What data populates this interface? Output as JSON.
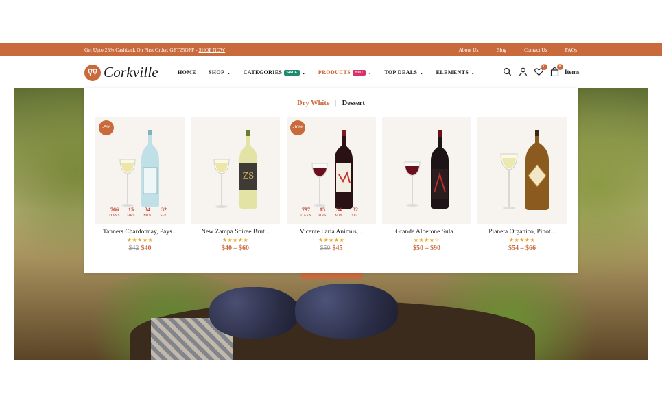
{
  "topbar": {
    "promo_text": "Get Upto 25% Cashback On First Order: GET25OFF - ",
    "promo_link": "SHOP NOW",
    "links": [
      "About Us",
      "Blog",
      "Contact Us",
      "FAQs"
    ]
  },
  "brand": {
    "name": "Corkville"
  },
  "nav": {
    "home": "HOME",
    "shop": "SHOP",
    "categories": "CATEGORIES",
    "categories_tag": "SALE",
    "products": "PRODUCTS",
    "products_tag": "HOT",
    "top_deals": "TOP DEALS",
    "elements": "ELEMENTS"
  },
  "header_icons": {
    "wishlist_count": "0",
    "cart_count": "0",
    "cart_label": "Items"
  },
  "mega": {
    "tab_active": "Dry White",
    "tab_separator": "|",
    "tab_other": "Dessert"
  },
  "countdown_labels": {
    "days": "DAYS",
    "hrs": "HRS",
    "min": "MIN",
    "sec": "SEC"
  },
  "products": [
    {
      "title": "Tanners Chardonnay, Pays...",
      "discount": "-5%",
      "old_price": "$42",
      "price": "$40",
      "rating": 5,
      "stars": "★★★★★",
      "countdown": {
        "days": "766",
        "hrs": "15",
        "min": "34",
        "sec": "32"
      }
    },
    {
      "title": "New Zampa Soiree Brut...",
      "discount": "",
      "old_price": "",
      "price": "$40 – $60",
      "rating": 5,
      "stars": "★★★★★"
    },
    {
      "title": "Vicente Faria Animus,...",
      "discount": "-10%",
      "old_price": "$50",
      "price": "$45",
      "rating": 5,
      "stars": "★★★★★",
      "countdown": {
        "days": "797",
        "hrs": "15",
        "min": "34",
        "sec": "32"
      }
    },
    {
      "title": "Grande Alberone Sula...",
      "discount": "",
      "old_price": "",
      "price": "$50 – $90",
      "rating": 4,
      "stars": "★★★★☆"
    },
    {
      "title": "Pianeta Organico, Pinot...",
      "discount": "",
      "old_price": "",
      "price": "$54 – $66",
      "rating": 5,
      "stars": "★★★★★"
    }
  ],
  "colors": {
    "accent": "#c96a3d",
    "countdown": "#c0392b",
    "star": "#e8a317",
    "sale_tag": "#1f8a70",
    "hot_tag": "#d6336c"
  }
}
